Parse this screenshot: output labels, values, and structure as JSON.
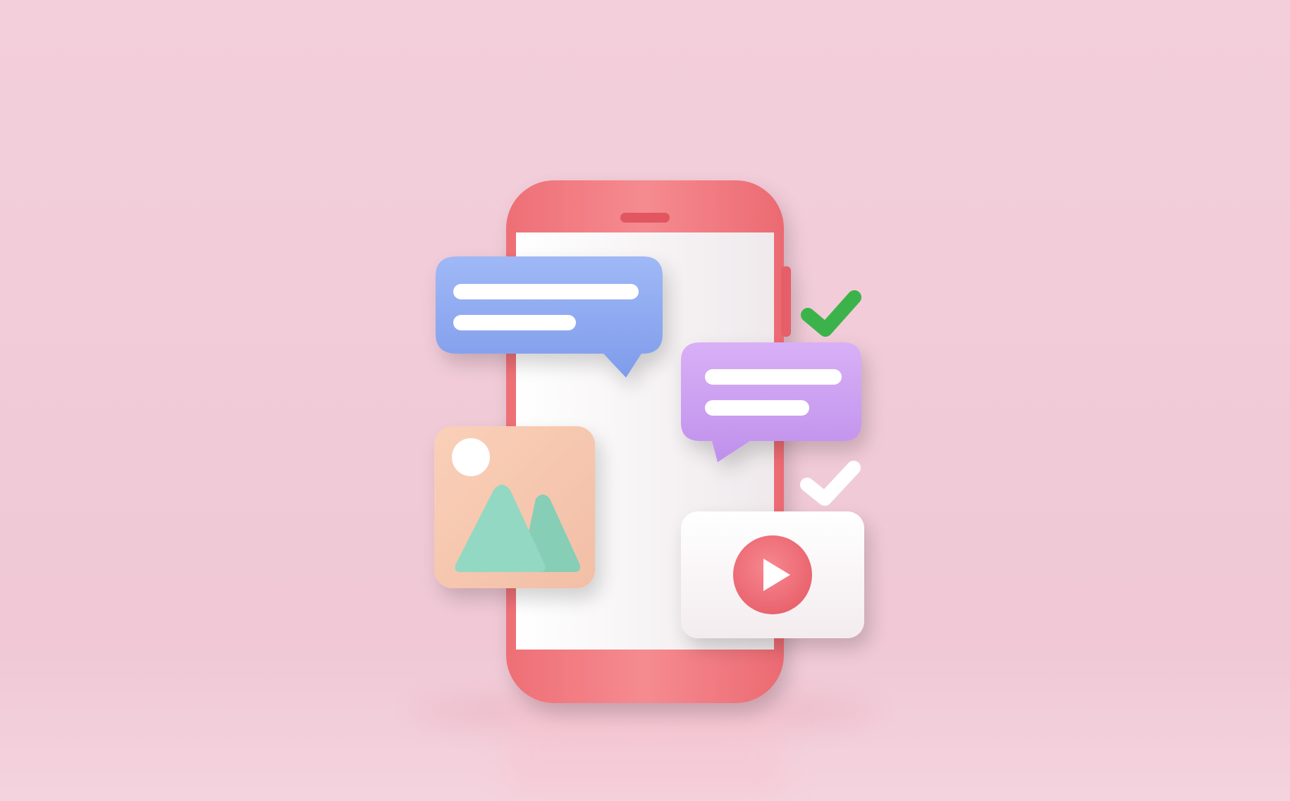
{
  "scene": {
    "colors": {
      "background": "#f1ccd8",
      "phone_body": "#f0767c",
      "phone_screen": "#f6f2f3",
      "blue_bubble": "#8aa6ef",
      "purple_bubble": "#c99cf0",
      "image_card": "#f7c9b0",
      "mountain": "#8fd6c0",
      "sun": "#ffffff",
      "video_card": "#fbf7f8",
      "play_button": "#f0707a",
      "check_green": "#3cb34a",
      "check_white": "#ffffff"
    },
    "icons": {
      "phone": "smartphone-icon",
      "blue_bubble": "speech-bubble-icon",
      "purple_bubble": "speech-bubble-icon",
      "image_card": "image-icon",
      "video_card": "video-play-icon",
      "check_green": "checkmark-icon",
      "check_white": "checkmark-icon"
    }
  }
}
